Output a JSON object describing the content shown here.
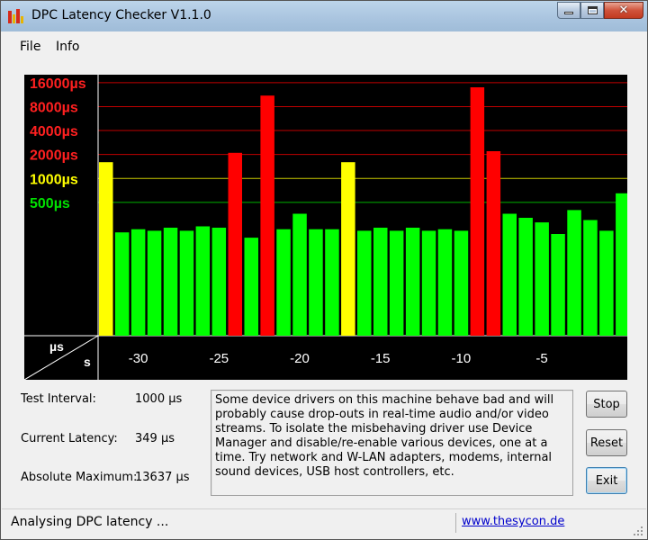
{
  "window": {
    "title": "DPC Latency Checker V1.1.0",
    "icon": "bar-chart-app-icon"
  },
  "menu": {
    "items": [
      {
        "label": "File"
      },
      {
        "label": "Info"
      }
    ]
  },
  "chart_data": {
    "type": "bar",
    "x_tick_labels": [
      "-30",
      "-25",
      "-20",
      "-15",
      "-10",
      "-5"
    ],
    "y_tick_labels": [
      {
        "label": "16000µs",
        "value": 16000,
        "color": "#ff2020"
      },
      {
        "label": "8000µs",
        "value": 8000,
        "color": "#ff2020"
      },
      {
        "label": "4000µs",
        "value": 4000,
        "color": "#ff2020"
      },
      {
        "label": "2000µs",
        "value": 2000,
        "color": "#ff2020"
      },
      {
        "label": "1000µs",
        "value": 1000,
        "color": "#ffff00"
      },
      {
        "label": "500µs",
        "value": 500,
        "color": "#00e000"
      }
    ],
    "corner_label_y": "µs",
    "corner_label_x": "s",
    "colors": {
      "green": "#00ff00",
      "yellow": "#ffff00",
      "red": "#ff0000",
      "background": "#000000"
    },
    "x": [
      -32,
      -31,
      -30,
      -29,
      -28,
      -27,
      -26,
      -25,
      -24,
      -23,
      -22,
      -21,
      -20,
      -19,
      -18,
      -17,
      -16,
      -15,
      -14,
      -13,
      -12,
      -11,
      -10,
      -9,
      -8,
      -7,
      -6,
      -5,
      -4,
      -3,
      -2,
      -1,
      0
    ],
    "values": [
      1600,
      210,
      230,
      220,
      240,
      220,
      250,
      240,
      2100,
      180,
      11000,
      230,
      360,
      230,
      230,
      1600,
      220,
      240,
      220,
      240,
      220,
      230,
      220,
      14000,
      2200,
      360,
      320,
      280,
      200,
      400,
      300,
      220,
      650
    ],
    "bar_colors": [
      "yellow",
      "green",
      "green",
      "green",
      "green",
      "green",
      "green",
      "green",
      "red",
      "green",
      "red",
      "green",
      "green",
      "green",
      "green",
      "yellow",
      "green",
      "green",
      "green",
      "green",
      "green",
      "green",
      "green",
      "red",
      "red",
      "green",
      "green",
      "green",
      "green",
      "green",
      "green",
      "green",
      "green"
    ]
  },
  "stats": {
    "test_interval_label": "Test Interval:",
    "test_interval_value": "1000 µs",
    "current_latency_label": "Current Latency:",
    "current_latency_value": "349 µs",
    "absolute_maximum_label": "Absolute Maximum:",
    "absolute_maximum_value": "13637 µs"
  },
  "message": "Some device drivers on this machine behave bad and will probably cause drop-outs in real-time audio and/or video streams. To isolate the misbehaving driver use Device Manager and disable/re-enable various devices, one at a time. Try network and W-LAN adapters, modems, internal sound devices, USB host controllers, etc.",
  "buttons": {
    "stop": "Stop",
    "reset": "Reset",
    "exit": "Exit"
  },
  "status": {
    "text": "Analysing DPC latency ...",
    "link": "www.thesycon.de"
  }
}
